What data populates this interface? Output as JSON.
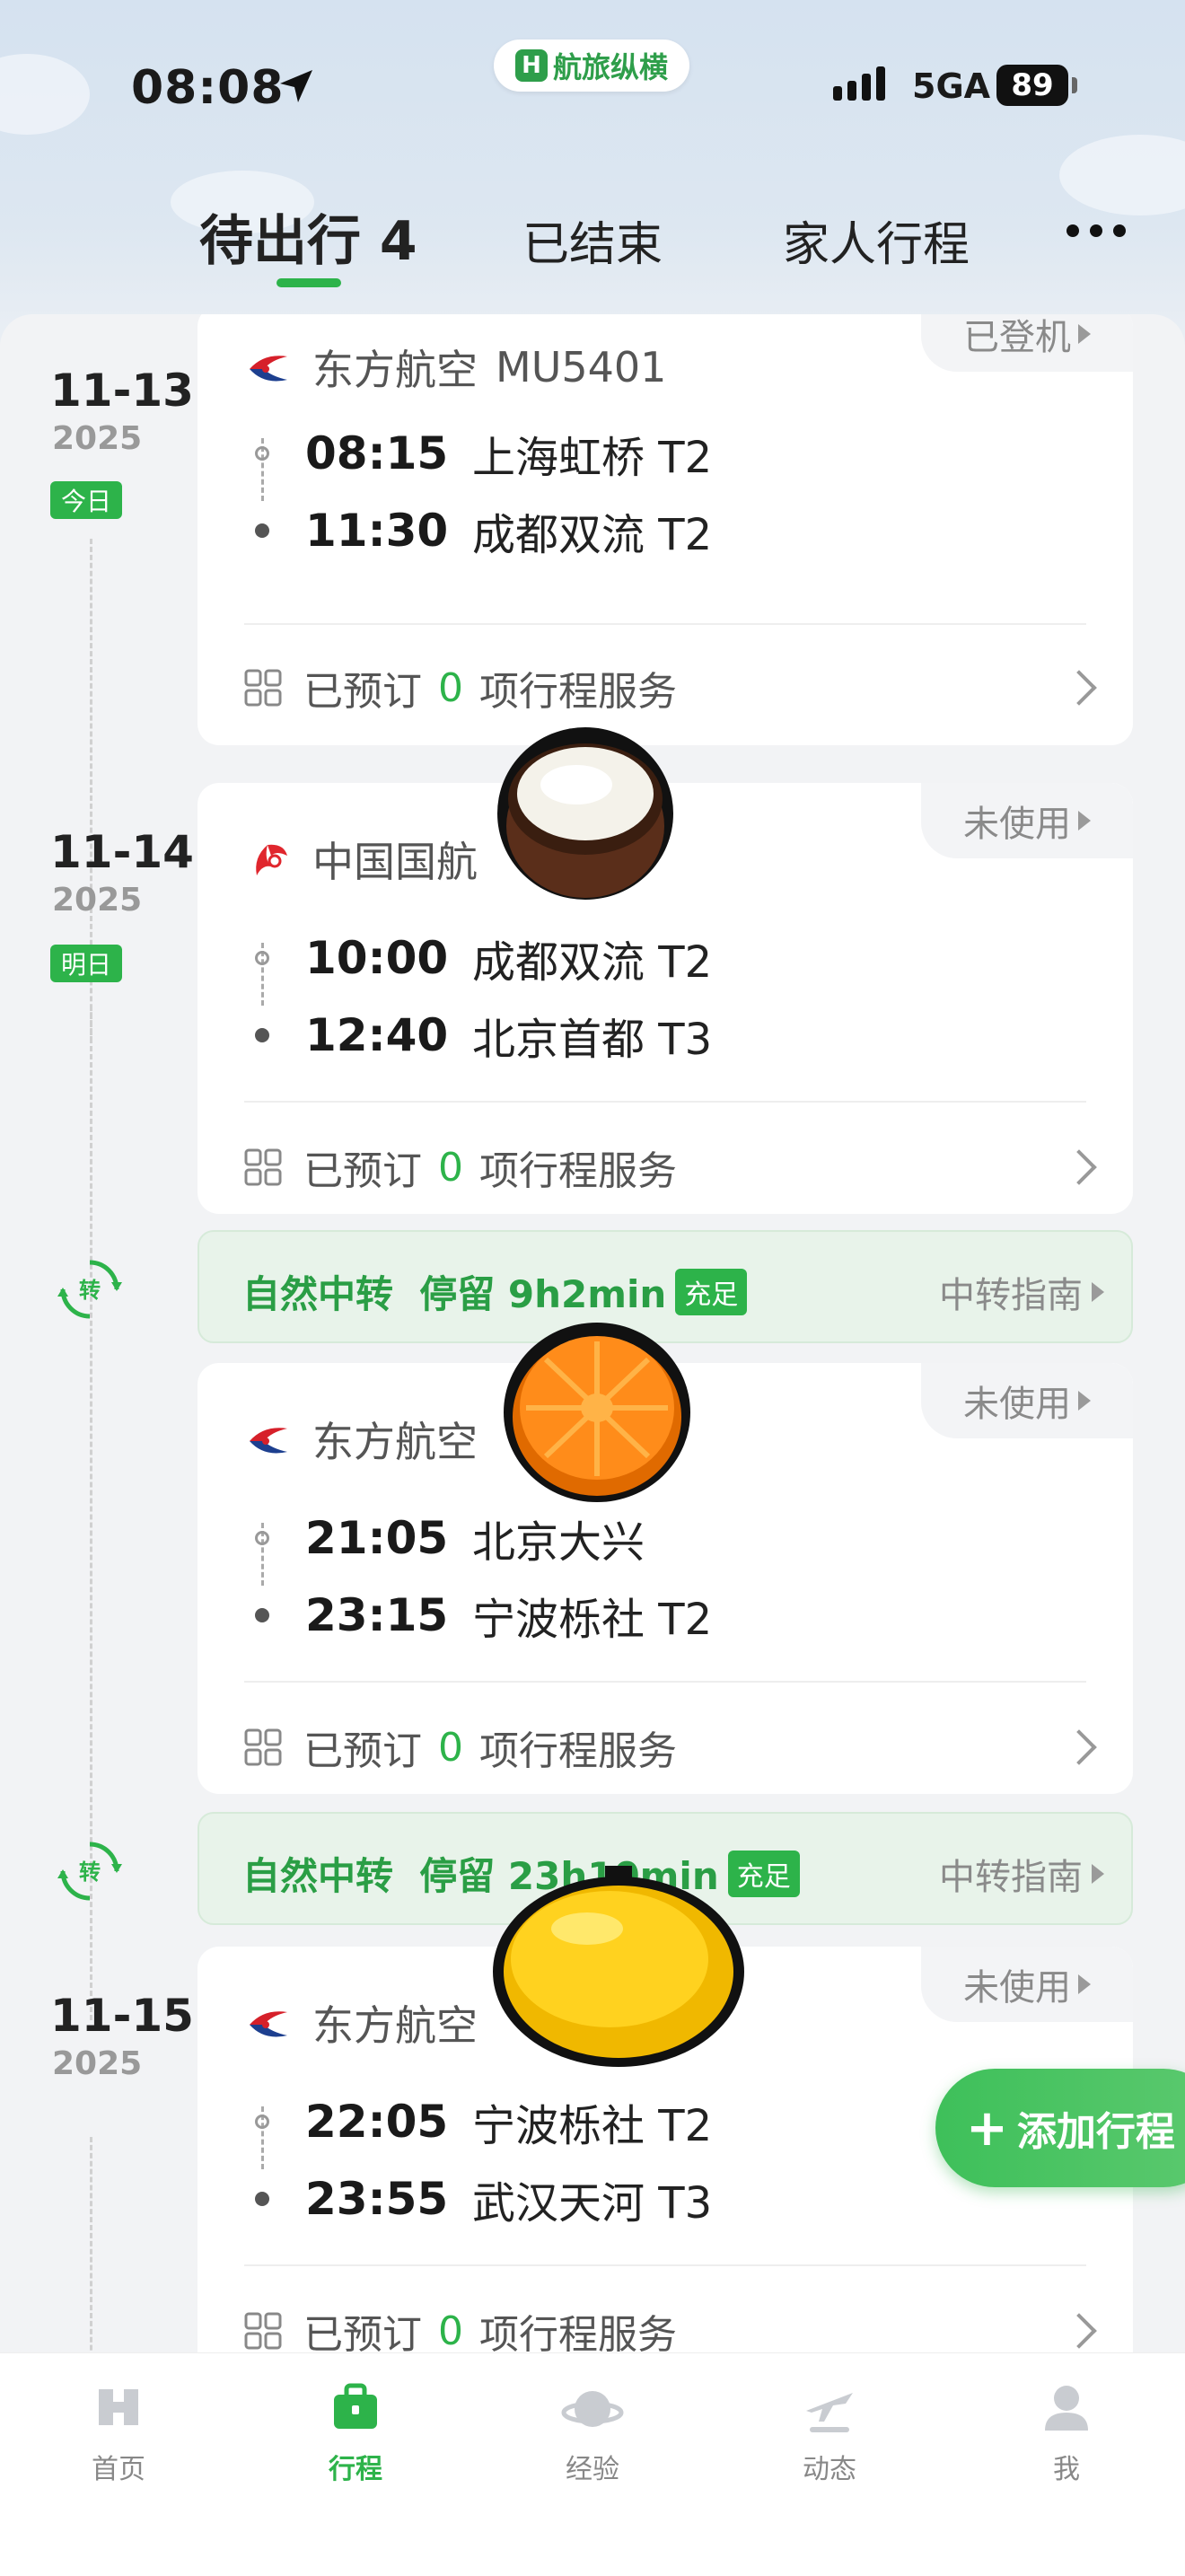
{
  "status_bar": {
    "time": "08:08",
    "brand": "航旅纵横",
    "network": "5GA",
    "battery": "89"
  },
  "tabs": [
    {
      "label": "待出行 4",
      "active": true
    },
    {
      "label": "已结束",
      "active": false
    },
    {
      "label": "家人行程",
      "active": false
    }
  ],
  "trips": [
    {
      "date": "11-13",
      "year": "2025",
      "day_badge": "今日",
      "airline": "东方航空",
      "flight_no": "MU5401",
      "status": "已登机",
      "departure": {
        "time": "08:15",
        "place": "上海虹桥 T2"
      },
      "arrival": {
        "time": "11:30",
        "place": "成都双流 T2"
      },
      "service_prefix": "已预订",
      "service_count": "0",
      "service_suffix": "项行程服务"
    },
    {
      "date": "11-14",
      "year": "2025",
      "day_badge": "明日",
      "airline": "中国国航",
      "status": "未使用",
      "departure": {
        "time": "10:00",
        "place": "成都双流 T2"
      },
      "arrival": {
        "time": "12:40",
        "place": "北京首都 T3"
      },
      "service_prefix": "已预订",
      "service_count": "0",
      "service_suffix": "项行程服务"
    },
    {
      "airline": "东方航空",
      "status": "未使用",
      "departure": {
        "time": "21:05",
        "place": "北京大兴"
      },
      "arrival": {
        "time": "23:15",
        "place": "宁波栎社 T2"
      },
      "service_prefix": "已预订",
      "service_count": "0",
      "service_suffix": "项行程服务"
    },
    {
      "date": "11-15",
      "year": "2025",
      "airline": "东方航空",
      "status": "未使用",
      "departure": {
        "time": "22:05",
        "place": "宁波栎社 T2"
      },
      "arrival": {
        "time": "23:55",
        "place": "武汉天河 T3"
      },
      "service_prefix": "已预订",
      "service_count": "0",
      "service_suffix": "项行程服务"
    }
  ],
  "transfers": [
    {
      "icon_label": "转",
      "label": "自然中转  停留 9h2min",
      "badge": "充足",
      "guide": "中转指南"
    },
    {
      "icon_label": "转",
      "label": "自然中转  停留 23h10min",
      "badge": "充足",
      "guide": "中转指南"
    }
  ],
  "fab": {
    "label": "添加行程"
  },
  "bottom_nav": [
    {
      "label": "首页",
      "icon": "home-icon"
    },
    {
      "label": "行程",
      "icon": "suitcase-icon",
      "active": true
    },
    {
      "label": "经验",
      "icon": "planet-icon"
    },
    {
      "label": "动态",
      "icon": "plane-icon"
    },
    {
      "label": "我",
      "icon": "person-icon"
    }
  ],
  "colors": {
    "accent": "#2db34a",
    "transfer_bg": "#e8f3ea",
    "eastern_red": "#d6202a",
    "eastern_blue": "#1d3f8f",
    "airchina_red": "#e0262d"
  }
}
